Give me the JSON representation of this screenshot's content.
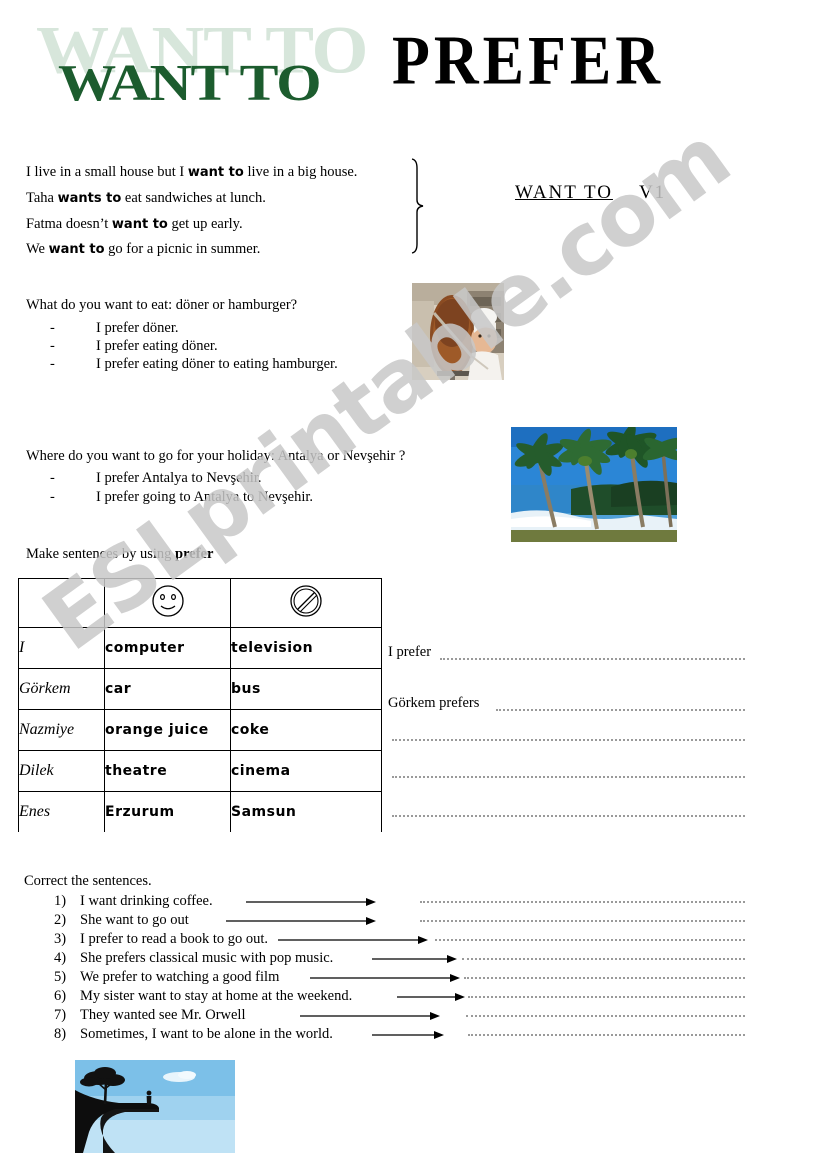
{
  "header": {
    "wordart_shadow": "WANT TO",
    "wordart_main": "WANT TO",
    "prefer_title": "PREFER"
  },
  "examples": {
    "lines": [
      {
        "pre": "I live in a small house but I ",
        "bold": "want to",
        "post": " live in a big house."
      },
      {
        "pre": "Taha ",
        "bold": "wants to",
        "post": " eat sandwiches at lunch."
      },
      {
        "pre": "Fatma doesn’t ",
        "bold": "want to",
        "post": " get up early."
      },
      {
        "pre": "We ",
        "bold": "want to",
        "post": " go for a picnic in summer."
      }
    ],
    "formula_underlined": "WANT  TO",
    "formula_tail": "V1"
  },
  "doner_section": {
    "question": "What do you want to eat: döner or hamburger?",
    "answers": [
      "I prefer döner.",
      "I prefer eating döner.",
      "I prefer eating döner to eating hamburger."
    ],
    "image_name": "doner-kebab-photo"
  },
  "holiday_section": {
    "question": "Where do you want to go for your holiday: Antalya or Nevşehir ?",
    "answers": [
      "I prefer Antalya to Nevşehir.",
      "I prefer going to Antalya to Nevşehir."
    ],
    "image_name": "tropical-beach-photo"
  },
  "table_section": {
    "instruction_pre": "Make sentences by using ",
    "instruction_bold": "prefer",
    "header_icons": [
      "smiley-face-icon",
      "prohibited-sign-icon"
    ],
    "rows": [
      {
        "name": "I",
        "like": "computer",
        "dislike": "television"
      },
      {
        "name": "Görkem",
        "like": "car",
        "dislike": "bus"
      },
      {
        "name": "Nazmiye",
        "like": "orange juice",
        "dislike": "coke"
      },
      {
        "name": "Dilek",
        "like": "theatre",
        "dislike": "cinema"
      },
      {
        "name": "Enes",
        "like": "Erzurum",
        "dislike": "Samsun"
      }
    ],
    "answer_starters": [
      "I prefer",
      "Görkem prefers"
    ],
    "blank_lines": 3
  },
  "correct_section": {
    "instruction": "Correct the sentences.",
    "items": [
      {
        "num": "1)",
        "text": "I want  drinking coffee."
      },
      {
        "num": "2)",
        "text": "She want to go out"
      },
      {
        "num": "3)",
        "text": "I prefer to read a book to go out."
      },
      {
        "num": "4)",
        "text": "She prefers classical music with pop music."
      },
      {
        "num": "5)",
        "text": "We prefer to watching a good film"
      },
      {
        "num": "6)",
        "text": "My sister want to stay at home at the weekend."
      },
      {
        "num": "7)",
        "text": "They wanted  see Mr. Orwell"
      },
      {
        "num": "8)",
        "text": "Sometimes, I want to be alone in the world."
      }
    ]
  },
  "footer": {
    "image_name": "cliff-silhouette-photo"
  },
  "watermark": {
    "text": "ESLprintable.com"
  },
  "colors": {
    "wordart_green": "#1c5c2e",
    "wordart_shadow": "#d7e6db",
    "watermark_gray": "#c8c8c8",
    "dotted_line": "#9a9a9a"
  }
}
